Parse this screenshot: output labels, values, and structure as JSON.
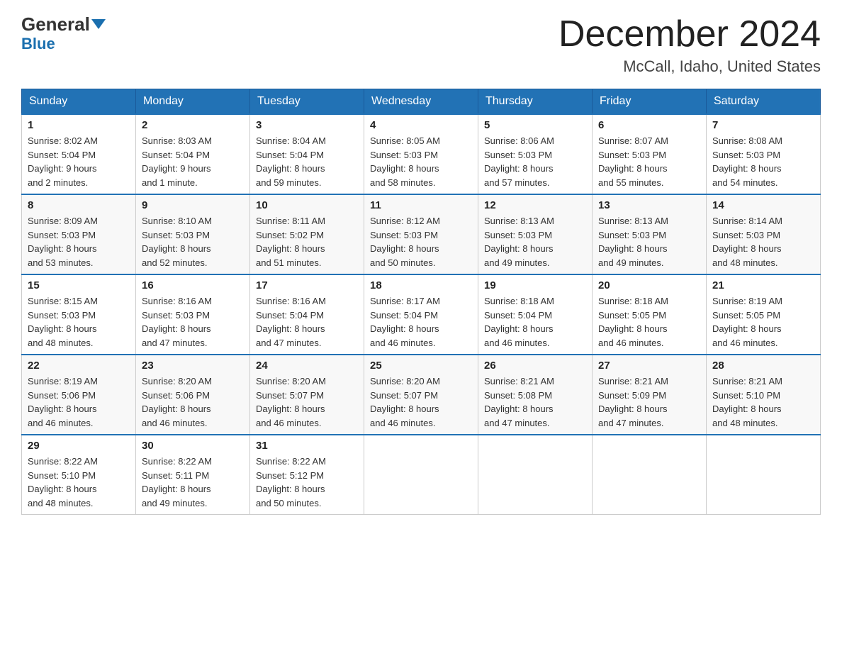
{
  "header": {
    "logo_general": "General",
    "logo_blue": "Blue",
    "title": "December 2024",
    "location": "McCall, Idaho, United States"
  },
  "days_of_week": [
    "Sunday",
    "Monday",
    "Tuesday",
    "Wednesday",
    "Thursday",
    "Friday",
    "Saturday"
  ],
  "weeks": [
    [
      {
        "day": "1",
        "sunrise": "Sunrise: 8:02 AM",
        "sunset": "Sunset: 5:04 PM",
        "daylight": "Daylight: 9 hours",
        "daylight2": "and 2 minutes."
      },
      {
        "day": "2",
        "sunrise": "Sunrise: 8:03 AM",
        "sunset": "Sunset: 5:04 PM",
        "daylight": "Daylight: 9 hours",
        "daylight2": "and 1 minute."
      },
      {
        "day": "3",
        "sunrise": "Sunrise: 8:04 AM",
        "sunset": "Sunset: 5:04 PM",
        "daylight": "Daylight: 8 hours",
        "daylight2": "and 59 minutes."
      },
      {
        "day": "4",
        "sunrise": "Sunrise: 8:05 AM",
        "sunset": "Sunset: 5:03 PM",
        "daylight": "Daylight: 8 hours",
        "daylight2": "and 58 minutes."
      },
      {
        "day": "5",
        "sunrise": "Sunrise: 8:06 AM",
        "sunset": "Sunset: 5:03 PM",
        "daylight": "Daylight: 8 hours",
        "daylight2": "and 57 minutes."
      },
      {
        "day": "6",
        "sunrise": "Sunrise: 8:07 AM",
        "sunset": "Sunset: 5:03 PM",
        "daylight": "Daylight: 8 hours",
        "daylight2": "and 55 minutes."
      },
      {
        "day": "7",
        "sunrise": "Sunrise: 8:08 AM",
        "sunset": "Sunset: 5:03 PM",
        "daylight": "Daylight: 8 hours",
        "daylight2": "and 54 minutes."
      }
    ],
    [
      {
        "day": "8",
        "sunrise": "Sunrise: 8:09 AM",
        "sunset": "Sunset: 5:03 PM",
        "daylight": "Daylight: 8 hours",
        "daylight2": "and 53 minutes."
      },
      {
        "day": "9",
        "sunrise": "Sunrise: 8:10 AM",
        "sunset": "Sunset: 5:03 PM",
        "daylight": "Daylight: 8 hours",
        "daylight2": "and 52 minutes."
      },
      {
        "day": "10",
        "sunrise": "Sunrise: 8:11 AM",
        "sunset": "Sunset: 5:02 PM",
        "daylight": "Daylight: 8 hours",
        "daylight2": "and 51 minutes."
      },
      {
        "day": "11",
        "sunrise": "Sunrise: 8:12 AM",
        "sunset": "Sunset: 5:03 PM",
        "daylight": "Daylight: 8 hours",
        "daylight2": "and 50 minutes."
      },
      {
        "day": "12",
        "sunrise": "Sunrise: 8:13 AM",
        "sunset": "Sunset: 5:03 PM",
        "daylight": "Daylight: 8 hours",
        "daylight2": "and 49 minutes."
      },
      {
        "day": "13",
        "sunrise": "Sunrise: 8:13 AM",
        "sunset": "Sunset: 5:03 PM",
        "daylight": "Daylight: 8 hours",
        "daylight2": "and 49 minutes."
      },
      {
        "day": "14",
        "sunrise": "Sunrise: 8:14 AM",
        "sunset": "Sunset: 5:03 PM",
        "daylight": "Daylight: 8 hours",
        "daylight2": "and 48 minutes."
      }
    ],
    [
      {
        "day": "15",
        "sunrise": "Sunrise: 8:15 AM",
        "sunset": "Sunset: 5:03 PM",
        "daylight": "Daylight: 8 hours",
        "daylight2": "and 48 minutes."
      },
      {
        "day": "16",
        "sunrise": "Sunrise: 8:16 AM",
        "sunset": "Sunset: 5:03 PM",
        "daylight": "Daylight: 8 hours",
        "daylight2": "and 47 minutes."
      },
      {
        "day": "17",
        "sunrise": "Sunrise: 8:16 AM",
        "sunset": "Sunset: 5:04 PM",
        "daylight": "Daylight: 8 hours",
        "daylight2": "and 47 minutes."
      },
      {
        "day": "18",
        "sunrise": "Sunrise: 8:17 AM",
        "sunset": "Sunset: 5:04 PM",
        "daylight": "Daylight: 8 hours",
        "daylight2": "and 46 minutes."
      },
      {
        "day": "19",
        "sunrise": "Sunrise: 8:18 AM",
        "sunset": "Sunset: 5:04 PM",
        "daylight": "Daylight: 8 hours",
        "daylight2": "and 46 minutes."
      },
      {
        "day": "20",
        "sunrise": "Sunrise: 8:18 AM",
        "sunset": "Sunset: 5:05 PM",
        "daylight": "Daylight: 8 hours",
        "daylight2": "and 46 minutes."
      },
      {
        "day": "21",
        "sunrise": "Sunrise: 8:19 AM",
        "sunset": "Sunset: 5:05 PM",
        "daylight": "Daylight: 8 hours",
        "daylight2": "and 46 minutes."
      }
    ],
    [
      {
        "day": "22",
        "sunrise": "Sunrise: 8:19 AM",
        "sunset": "Sunset: 5:06 PM",
        "daylight": "Daylight: 8 hours",
        "daylight2": "and 46 minutes."
      },
      {
        "day": "23",
        "sunrise": "Sunrise: 8:20 AM",
        "sunset": "Sunset: 5:06 PM",
        "daylight": "Daylight: 8 hours",
        "daylight2": "and 46 minutes."
      },
      {
        "day": "24",
        "sunrise": "Sunrise: 8:20 AM",
        "sunset": "Sunset: 5:07 PM",
        "daylight": "Daylight: 8 hours",
        "daylight2": "and 46 minutes."
      },
      {
        "day": "25",
        "sunrise": "Sunrise: 8:20 AM",
        "sunset": "Sunset: 5:07 PM",
        "daylight": "Daylight: 8 hours",
        "daylight2": "and 46 minutes."
      },
      {
        "day": "26",
        "sunrise": "Sunrise: 8:21 AM",
        "sunset": "Sunset: 5:08 PM",
        "daylight": "Daylight: 8 hours",
        "daylight2": "and 47 minutes."
      },
      {
        "day": "27",
        "sunrise": "Sunrise: 8:21 AM",
        "sunset": "Sunset: 5:09 PM",
        "daylight": "Daylight: 8 hours",
        "daylight2": "and 47 minutes."
      },
      {
        "day": "28",
        "sunrise": "Sunrise: 8:21 AM",
        "sunset": "Sunset: 5:10 PM",
        "daylight": "Daylight: 8 hours",
        "daylight2": "and 48 minutes."
      }
    ],
    [
      {
        "day": "29",
        "sunrise": "Sunrise: 8:22 AM",
        "sunset": "Sunset: 5:10 PM",
        "daylight": "Daylight: 8 hours",
        "daylight2": "and 48 minutes."
      },
      {
        "day": "30",
        "sunrise": "Sunrise: 8:22 AM",
        "sunset": "Sunset: 5:11 PM",
        "daylight": "Daylight: 8 hours",
        "daylight2": "and 49 minutes."
      },
      {
        "day": "31",
        "sunrise": "Sunrise: 8:22 AM",
        "sunset": "Sunset: 5:12 PM",
        "daylight": "Daylight: 8 hours",
        "daylight2": "and 50 minutes."
      },
      {
        "day": "",
        "sunrise": "",
        "sunset": "",
        "daylight": "",
        "daylight2": ""
      },
      {
        "day": "",
        "sunrise": "",
        "sunset": "",
        "daylight": "",
        "daylight2": ""
      },
      {
        "day": "",
        "sunrise": "",
        "sunset": "",
        "daylight": "",
        "daylight2": ""
      },
      {
        "day": "",
        "sunrise": "",
        "sunset": "",
        "daylight": "",
        "daylight2": ""
      }
    ]
  ]
}
